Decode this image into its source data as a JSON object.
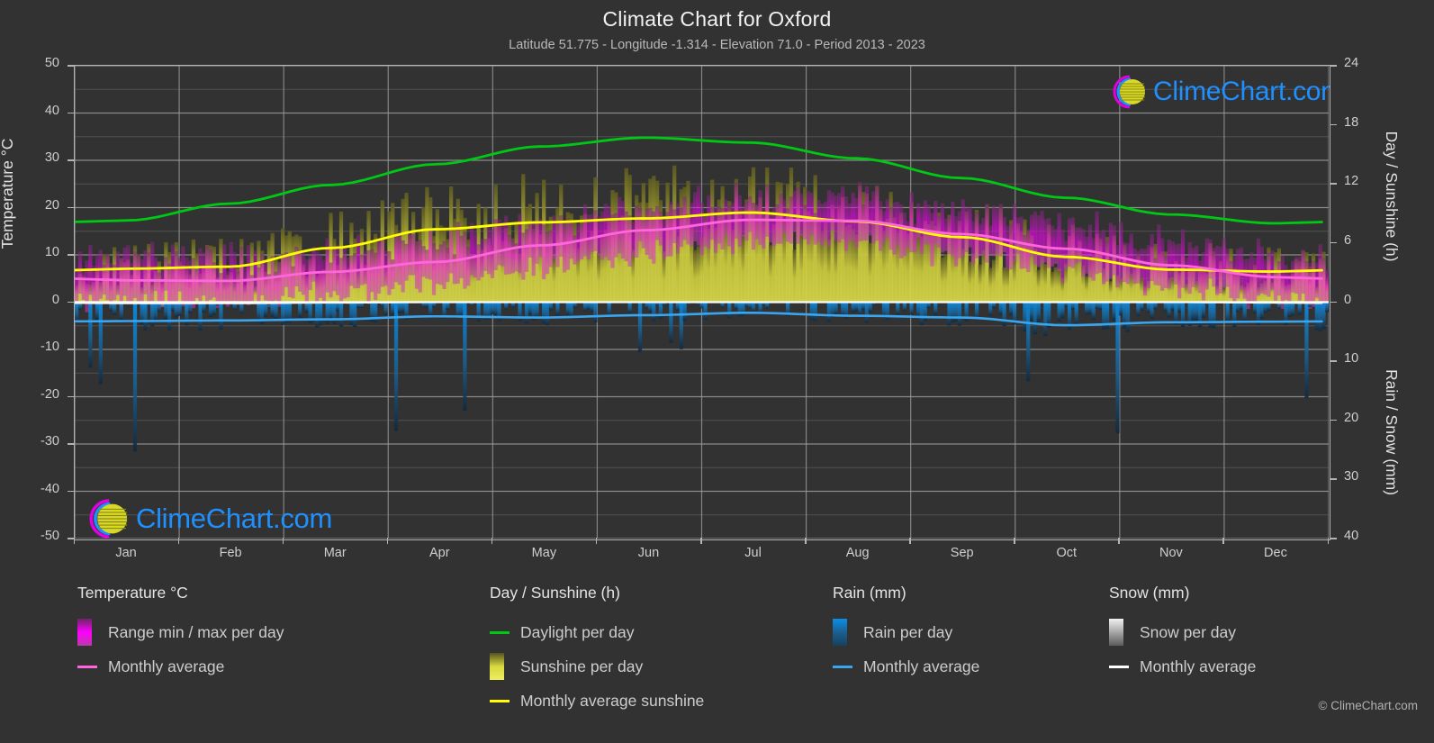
{
  "header": {
    "title": "Climate Chart for Oxford",
    "subtitle": "Latitude 51.775 - Longitude -1.314 - Elevation 71.0 - Period 2013 - 2023"
  },
  "watermark": {
    "text": "ClimeChart.com",
    "copyright": "© ClimeChart.com"
  },
  "axes": {
    "left_label": "Temperature °C",
    "right_top_label": "Day / Sunshine (h)",
    "right_bottom_label": "Rain / Snow (mm)",
    "left_ticks": [
      "50",
      "40",
      "30",
      "20",
      "10",
      "0",
      "-10",
      "-20",
      "-30",
      "-40",
      "-50"
    ],
    "right_top_ticks": [
      "24",
      "18",
      "12",
      "6",
      "0"
    ],
    "right_bottom_ticks": [
      "0",
      "10",
      "20",
      "30",
      "40"
    ]
  },
  "legend": {
    "temperature": {
      "title": "Temperature °C",
      "items": [
        {
          "label": "Range min / max per day",
          "swatch": "gradient-box",
          "color": "#ff00ff"
        },
        {
          "label": "Monthly average",
          "swatch": "line",
          "color": "#ff66dd"
        }
      ]
    },
    "day_sunshine": {
      "title": "Day / Sunshine (h)",
      "items": [
        {
          "label": "Daylight per day",
          "swatch": "line",
          "color": "#00c814"
        },
        {
          "label": "Sunshine per day",
          "swatch": "gradient-box",
          "color": "#eeee44"
        },
        {
          "label": "Monthly average sunshine",
          "swatch": "line",
          "color": "#ffff00"
        }
      ]
    },
    "rain": {
      "title": "Rain (mm)",
      "items": [
        {
          "label": "Rain per day",
          "swatch": "gradient-box",
          "color": "#0096ff"
        },
        {
          "label": "Monthly average",
          "swatch": "line",
          "color": "#3aa6f0"
        }
      ]
    },
    "snow": {
      "title": "Snow (mm)",
      "items": [
        {
          "label": "Snow per day",
          "swatch": "gradient-box",
          "color": "#ffffff"
        },
        {
          "label": "Monthly average",
          "swatch": "line",
          "color": "#ffffff"
        }
      ]
    }
  },
  "chart_data": {
    "type": "line",
    "title": "Climate Chart for Oxford",
    "subtitle": "Latitude 51.775 - Longitude -1.314 - Elevation 71.0 - Period 2013 - 2023",
    "xlabel": "",
    "ylabel": "Temperature °C",
    "ylabel_right_top": "Day / Sunshine (h)",
    "ylabel_right_bottom": "Rain / Snow (mm)",
    "ylim": [
      -50,
      50
    ],
    "ylim_right_top": [
      0,
      24
    ],
    "ylim_right_bottom": [
      0,
      40
    ],
    "grid": true,
    "legend_position": "below",
    "categories": [
      "Jan",
      "Feb",
      "Mar",
      "Apr",
      "May",
      "Jun",
      "Jul",
      "Aug",
      "Sep",
      "Oct",
      "Nov",
      "Dec"
    ],
    "series": [
      {
        "name": "Daylight per day",
        "units": "h",
        "axis": "right_top",
        "color": "#00c814",
        "values": [
          8.3,
          10.0,
          11.9,
          14.0,
          15.8,
          16.7,
          16.2,
          14.6,
          12.6,
          10.6,
          8.9,
          8.0
        ]
      },
      {
        "name": "Monthly average sunshine",
        "units": "h",
        "axis": "right_top",
        "color": "#ffff00",
        "values": [
          3.4,
          3.6,
          5.5,
          7.4,
          8.1,
          8.5,
          9.1,
          8.2,
          6.6,
          4.6,
          3.3,
          3.1
        ]
      },
      {
        "name": "Monthly average temperature",
        "units": "°C",
        "axis": "left",
        "color": "#ff66dd",
        "values": [
          4.6,
          4.5,
          6.4,
          8.5,
          12.0,
          15.2,
          17.4,
          17.2,
          14.4,
          11.3,
          7.8,
          5.3
        ]
      },
      {
        "name": "Monthly average rain",
        "units": "mm",
        "axis": "right_bottom",
        "color": "#3aa6f0",
        "values": [
          3.2,
          3.1,
          2.9,
          2.4,
          2.6,
          2.2,
          1.8,
          2.3,
          2.6,
          3.9,
          3.4,
          3.3
        ]
      },
      {
        "name": "Monthly average snow",
        "units": "mm",
        "axis": "right_bottom",
        "color": "#ffffff",
        "values": [
          0.2,
          0.2,
          0.1,
          0.0,
          0.0,
          0.0,
          0.0,
          0.0,
          0.0,
          0.0,
          0.0,
          0.1
        ]
      }
    ],
    "daily_bands": [
      {
        "name": "Range min / max per day",
        "axis": "left",
        "color": "#ff00ff",
        "description": "Daily min/max temperature range bars, magenta gradient"
      },
      {
        "name": "Sunshine per day",
        "axis": "right_top",
        "color": "#eeee44",
        "description": "Daily sunshine hours bars, yellow gradient"
      },
      {
        "name": "Rain per day",
        "axis": "right_bottom",
        "color": "#0096ff",
        "description": "Daily rainfall bars, blue gradient, drawn downward from zero"
      },
      {
        "name": "Snow per day",
        "axis": "right_bottom",
        "color": "#ffffff",
        "description": "Daily snowfall bars, white/grey gradient, drawn downward from zero"
      }
    ]
  }
}
